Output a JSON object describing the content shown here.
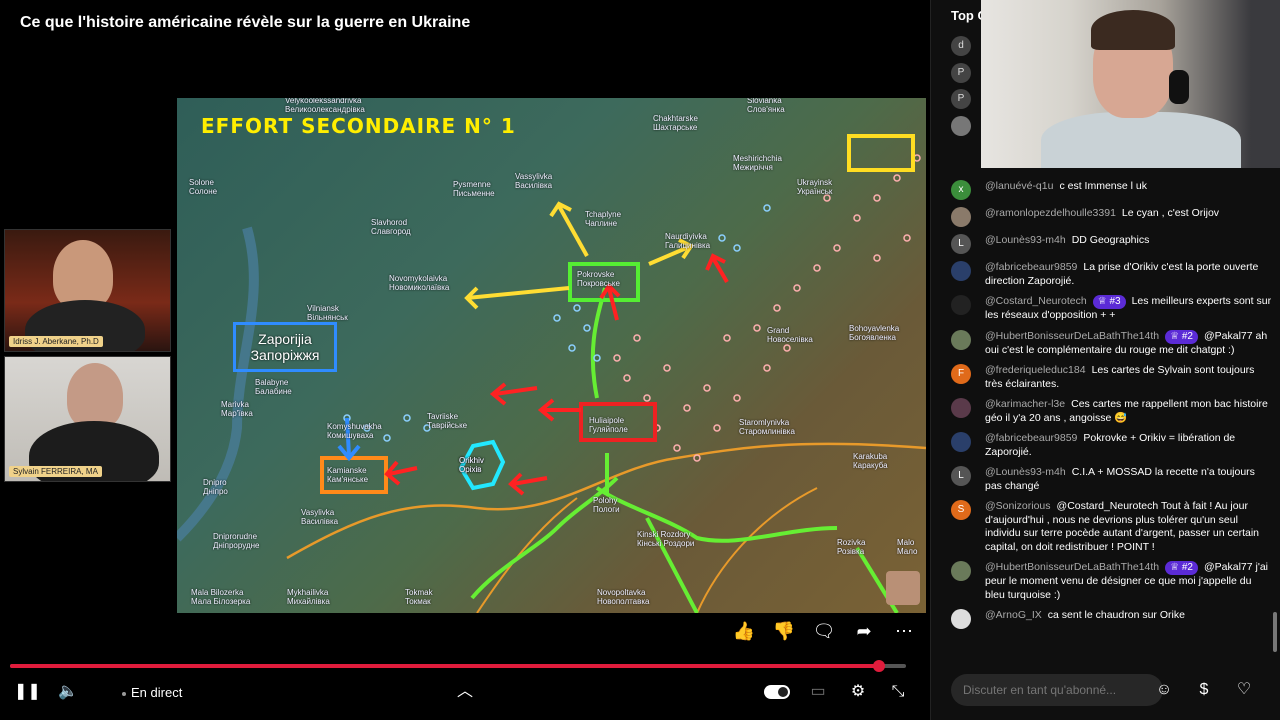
{
  "video": {
    "title": "Ce que l'histoire américaine révèle sur la guerre en Ukraine",
    "map": {
      "title": "EFFORT SECONDAIRE N° 1",
      "zaporijia_label_1": "Zaporijia",
      "zaporijia_label_2": "Запоріжжя",
      "place_labels": [
        "Velykoolekssandrivka\nВеликоолександрівка",
        "Vassylivka\nВасилівка",
        "Pysmenne\nПисьменне",
        "Chakhtarske\nШахтарське",
        "Slovianka\nСлов'янка",
        "Solone\nСолоне",
        "Slavhorod\nСлавгород",
        "Tchaplyne\nЧаплине",
        "Meshirichchia\nМежиріччя",
        "Novomykolaivka\nНовомиколаївка",
        "Pokrovske\nПокровське",
        "Naurdiyivka\nГалицинівка",
        "Vilniansk\nВільнянськ",
        "Grand\nНовоселівка",
        "Bohoyavlenka\nБогоявленка",
        "Balabyne\nБалабине",
        "Huliaipole\nГуляйполе",
        "Staromlynivka\nСтаромлинівка",
        "Marivka\nМар'ївка",
        "Komyshuvakha\nКомишуваха",
        "Tavriiske\nТаврійське",
        "Orikhiv\nОріхів",
        "Kamianske\nКам'янське",
        "Vasylivka\nВасилівка",
        "Dniprorudne\nДніпрорудне",
        "Polohy\nПологи",
        "Kinski Rozdory\nКінські Роздори",
        "Karakuba\nКаракуба",
        "Rozivka\nРозівка",
        "Malo\nМало",
        "Mala Bilozerka\nМала Білозерка",
        "Mykhailivka\nМихайлівка",
        "Tokmak\nТокмак",
        "Novopoltavka\nНовополтавка",
        "Ukrayinsk\nУкраїнськ",
        "Dnipro\nДніпро",
        "Orikhiv\nОріхів"
      ]
    },
    "cams": [
      {
        "name_tag": "Idriss J. Aberkane, Ph.D"
      },
      {
        "name_tag": "Sylvain FERREIRA, MA"
      }
    ],
    "progress_fraction": 0.97,
    "live_label": "En direct"
  },
  "chat": {
    "header": "Top C",
    "mini_avatars": [
      "d",
      "P",
      "P",
      ""
    ],
    "messages": [
      {
        "author": "@lanuévé-q1u",
        "text": "c est Immense l uk",
        "avatar_letter": "x",
        "avatar_color": "#3b8e3b"
      },
      {
        "author": "@ramonlopezdelhoulle3391",
        "text": "Le cyan , c'est Orijov",
        "avatar_letter": "",
        "avatar_color": "#8a7a6a"
      },
      {
        "author": "@Lounès93-m4h",
        "text": "DD Geographics",
        "avatar_letter": "L",
        "avatar_color": "#555"
      },
      {
        "author": "@fabricebeaur9859",
        "text": "La prise d'Orikiv c'est la porte ouverte direction Zaporojié.",
        "avatar_letter": "",
        "avatar_color": "#2a3f6a"
      },
      {
        "author": "@Costard_Neurotech",
        "badge": "#3",
        "text": "Les meilleurs experts sont sur les réseaux d'opposition + +",
        "avatar_letter": "",
        "avatar_color": "#222"
      },
      {
        "author": "@HubertBonisseurDeLaBathThe14th",
        "badge": "#2",
        "text": "@Pakal77 ah oui c'est le complémentaire du rouge me dit chatgpt :)",
        "avatar_letter": "",
        "avatar_color": "#6a7a5a"
      },
      {
        "author": "@frederiqueleduc184",
        "text": "Les cartes de Sylvain sont toujours très éclairantes.",
        "avatar_letter": "F",
        "avatar_color": "#e06a1a"
      },
      {
        "author": "@karimacher-l3e",
        "text": "Ces cartes me rappellent mon bac histoire géo il y'a 20 ans , angoisse 😅",
        "avatar_letter": "",
        "avatar_color": "#5a3a4a"
      },
      {
        "author": "@fabricebeaur9859",
        "text": "Pokrovke + Orikiv = libération de Zaporojié.",
        "avatar_letter": "",
        "avatar_color": "#2a3f6a"
      },
      {
        "author": "@Lounès93-m4h",
        "text": "C.I.A + MOSSAD la recette n'a toujours pas changé",
        "avatar_letter": "L",
        "avatar_color": "#555"
      },
      {
        "author": "@Sonizorious",
        "text": "@Costard_Neurotech Tout à fait ! Au jour d'aujourd'hui , nous ne devrions plus tolérer qu'un seul individu sur terre pocède autant d'argent, passer un certain capital, on doit redistribuer ! POINT !",
        "avatar_letter": "S",
        "avatar_color": "#e06a1a"
      },
      {
        "author": "@HubertBonisseurDeLaBathThe14th",
        "badge": "#2",
        "text": "@Pakal77 j'ai peur le moment venu de désigner ce que moi j'appelle du bleu turquoise :)",
        "avatar_letter": "",
        "avatar_color": "#6a7a5a"
      },
      {
        "author": "@ArnoG_IX",
        "text": "ca sent le chaudron sur Orike",
        "avatar_letter": "",
        "avatar_color": "#ddd"
      }
    ],
    "input_placeholder": "Discuter en tant qu'abonné..."
  }
}
